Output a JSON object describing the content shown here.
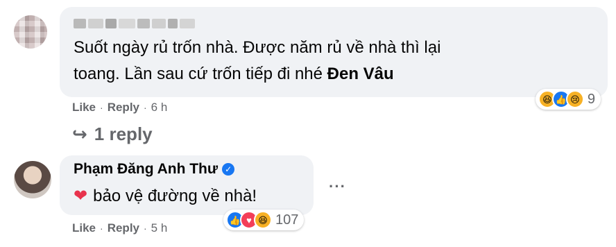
{
  "comment1": {
    "author_redacted": "",
    "text_line1": "Suốt ngày rủ trốn nhà. Được năm rủ về nhà thì lại",
    "text_line2": "toang. Lần sau cứ trốn tiếp đi nhé",
    "mention": "Đen Vâu",
    "actions": {
      "like": "Like",
      "reply": "Reply",
      "time": "6 h"
    },
    "reactions": {
      "icons": [
        "haha-icon",
        "like-icon",
        "sad-icon"
      ],
      "count": "9"
    }
  },
  "replies_link": {
    "label": "1 reply"
  },
  "comment2": {
    "author": "Phạm Đăng Anh Thư",
    "verified": true,
    "emoji": "❤",
    "text": "bảo vệ đường về nhà!",
    "actions": {
      "like": "Like",
      "reply": "Reply",
      "time": "5 h"
    },
    "reactions": {
      "icons": [
        "like-icon",
        "love-icon",
        "haha-icon"
      ],
      "count": "107"
    }
  },
  "colors": {
    "bubble": "#f0f2f5",
    "secondary_text": "#65676b",
    "facebook_blue": "#1877f2",
    "love_red": "#f33e58",
    "haha_yellow": "#f7b125"
  }
}
